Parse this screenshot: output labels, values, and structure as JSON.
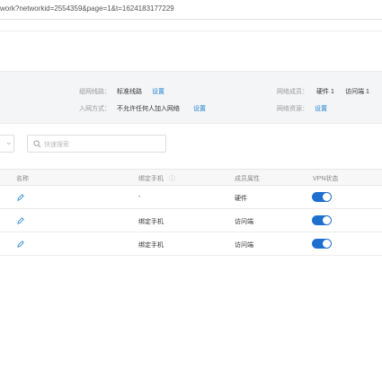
{
  "url": "work?networkid=2554359&page=1&t=1624183177229",
  "info": {
    "group_route_label": "组网线路：",
    "group_route_value": "标准线路",
    "group_route_link": "设置",
    "join_label": "入网方式：",
    "join_value": "不允许任何人加入网络",
    "join_link": "设置",
    "members_label": "网络成员：",
    "members_hardware": "硬件 1",
    "members_visitor": "访问端 1",
    "resources_label": "网络资源：",
    "resources_link": "设置"
  },
  "search": {
    "placeholder": "快速搜索"
  },
  "table": {
    "headers": {
      "name": "名称",
      "phone": "绑定手机",
      "phone_sub": "ⓘ",
      "attr": "成员属性",
      "vpn": "VPN状态"
    },
    "rows": [
      {
        "phone": "-",
        "attr": "硬件",
        "vpn_on": true
      },
      {
        "phone": "绑定手机",
        "attr": "访问端",
        "vpn_on": true
      },
      {
        "phone": "绑定手机",
        "attr": "访问端",
        "vpn_on": true
      }
    ]
  },
  "colors": {
    "accent": "#1f82d2",
    "toggle": "#1f6fd1"
  }
}
